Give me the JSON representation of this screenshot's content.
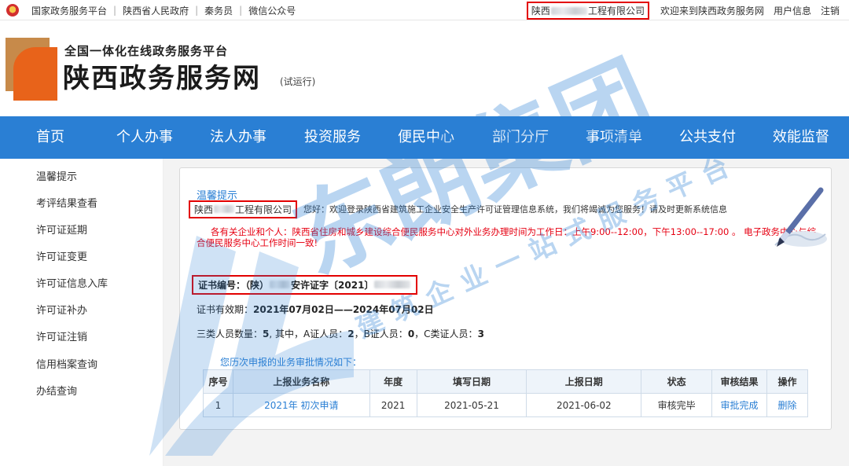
{
  "topbar": {
    "links": [
      "国家政务服务平台",
      "陕西省人民政府",
      "秦务员",
      "微信公众号"
    ],
    "separator": "|",
    "company_prefix": "陕西",
    "company_suffix": "工程有限公司",
    "right_links": [
      "欢迎来到陕西政务服务网",
      "用户信息",
      "注销"
    ]
  },
  "header": {
    "slogan": "全国一体化在线政务服务平台",
    "title": "陕西政务服务网",
    "trial": "(试运行)"
  },
  "nav": {
    "items": [
      "首页",
      "个人办事",
      "法人办事",
      "投资服务",
      "便民中心",
      "部门分厅",
      "事项清单",
      "公共支付",
      "效能监督"
    ]
  },
  "sidebar": {
    "items": [
      "温馨提示",
      "考评结果查看",
      "许可证延期",
      "许可证变更",
      "许可证信息入库",
      "许可证补办",
      "许可证注销",
      "信用档案查询",
      "办结查询"
    ]
  },
  "main": {
    "title": "温馨提示",
    "company_prefix": "陕西",
    "company_suffix": "工程有限公司",
    "greeting": "您好：欢迎登录陕西省建筑施工企业安全生产许可证管理信息系统，我们将竭诚为您服务！请及时更新系统信息",
    "notice": "各有关企业和个人：陕西省住房和城乡建设综合便民服务中心对外业务办理时间为工作日：上午9:00--12:00，下午13:00--17:00 。 电子政务中心与综合便民服务中心工作时间一致!",
    "cert_label": "证书编号：（陕）",
    "cert_mid": "安许证字〔2021〕",
    "valid_label": "证书有效期：",
    "valid_value": "2021年07月02日——2024年07月02日",
    "staff_prefix": "三类人员数量：",
    "staff_total": "5",
    "staff_mid": ", 其中，A证人员：",
    "staff_a": "2",
    "staff_b_label": "，B证人员：",
    "staff_b": "0",
    "staff_c_label": "，C类证人员：",
    "staff_c": "3",
    "history": "您历次申报的业务审批情况如下："
  },
  "table": {
    "headers": [
      "序号",
      "上报业务名称",
      "年度",
      "填写日期",
      "上报日期",
      "状态",
      "审核结果",
      "操作"
    ],
    "rows": [
      [
        "1",
        "2021年 初次申请",
        "2021",
        "2021-05-21",
        "2021-06-02",
        "审核完毕",
        "审批完成",
        "删除"
      ]
    ]
  },
  "watermark": {
    "brand": "东朗集团",
    "tagline": "建筑企业一站式服务平台"
  },
  "colors": {
    "nav_bg": "#2a7fd4",
    "link": "#2a7fd4",
    "alert": "#e60012",
    "highlight_box": "#e30000"
  }
}
